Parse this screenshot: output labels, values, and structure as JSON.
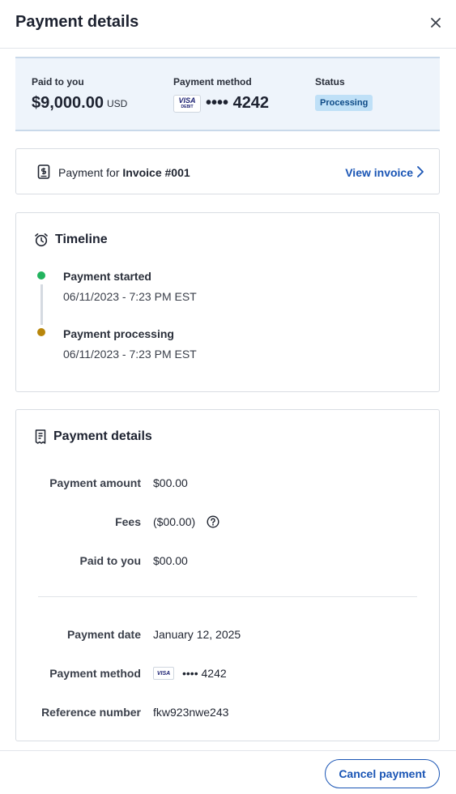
{
  "header": {
    "title": "Payment details"
  },
  "summary": {
    "paid_label": "Paid to you",
    "paid_amount": "$9,000.00",
    "paid_currency": "USD",
    "method_label": "Payment method",
    "method_brand": "VISA",
    "method_brand_sub": "DEBIT",
    "method_masked": "•••• 4242",
    "status_label": "Status",
    "status_value": "Processing"
  },
  "invoice": {
    "prefix": "Payment for ",
    "number": "Invoice #001",
    "link_label": "View invoice"
  },
  "timeline": {
    "title": "Timeline",
    "events": [
      {
        "title": "Payment started",
        "date": "06/11/2023 - 7:23 PM EST",
        "color": "#22b35e"
      },
      {
        "title": "Payment processing",
        "date": "06/11/2023 - 7:23 PM EST",
        "color": "#b8860b"
      }
    ]
  },
  "details": {
    "title": "Payment details",
    "amount_label": "Payment amount",
    "amount_value": "$00.00",
    "fees_label": "Fees",
    "fees_value": "($00.00)",
    "paid_label": "Paid to you",
    "paid_value": "$00.00",
    "date_label": "Payment date",
    "date_value": "January 12, 2025",
    "method_label": "Payment method",
    "method_brand": "VISA",
    "method_masked": "•••• 4242",
    "reference_label": "Reference number",
    "reference_value": "fkw923nwe243"
  },
  "footer": {
    "cancel_label": "Cancel payment"
  },
  "colors": {
    "accent": "#1a55b5",
    "summary_bg": "#eef4fb",
    "status_badge_bg": "#bfe0f7"
  }
}
